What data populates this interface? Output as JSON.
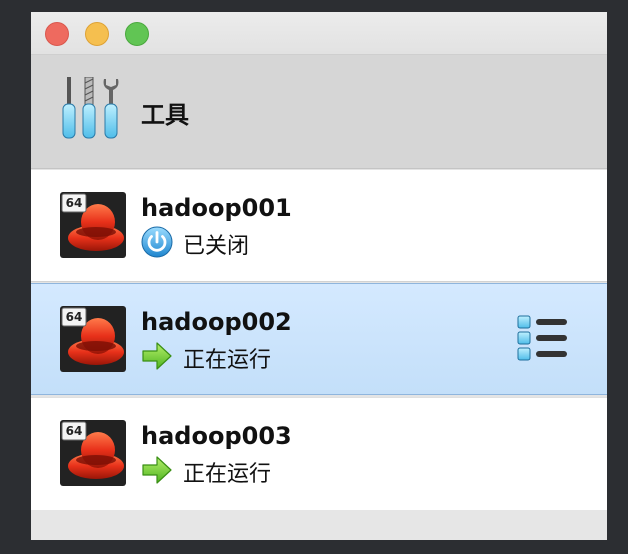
{
  "window": {
    "controls": [
      "close",
      "minimize",
      "zoom"
    ]
  },
  "tools": {
    "label": "工具",
    "icon": "tools-icon"
  },
  "vms": [
    {
      "name": "hadoop001",
      "state": "已关闭",
      "state_icon": "power-icon",
      "os_badge": "64",
      "selected": false
    },
    {
      "name": "hadoop002",
      "state": "正在运行",
      "state_icon": "running-arrow-icon",
      "os_badge": "64",
      "selected": true
    },
    {
      "name": "hadoop003",
      "state": "正在运行",
      "state_icon": "running-arrow-icon",
      "os_badge": "64",
      "selected": false
    }
  ],
  "colors": {
    "selected_row": "#c8e2fb",
    "running_arrow": "#6dcc2e",
    "power_button": "#3aa0e0"
  }
}
